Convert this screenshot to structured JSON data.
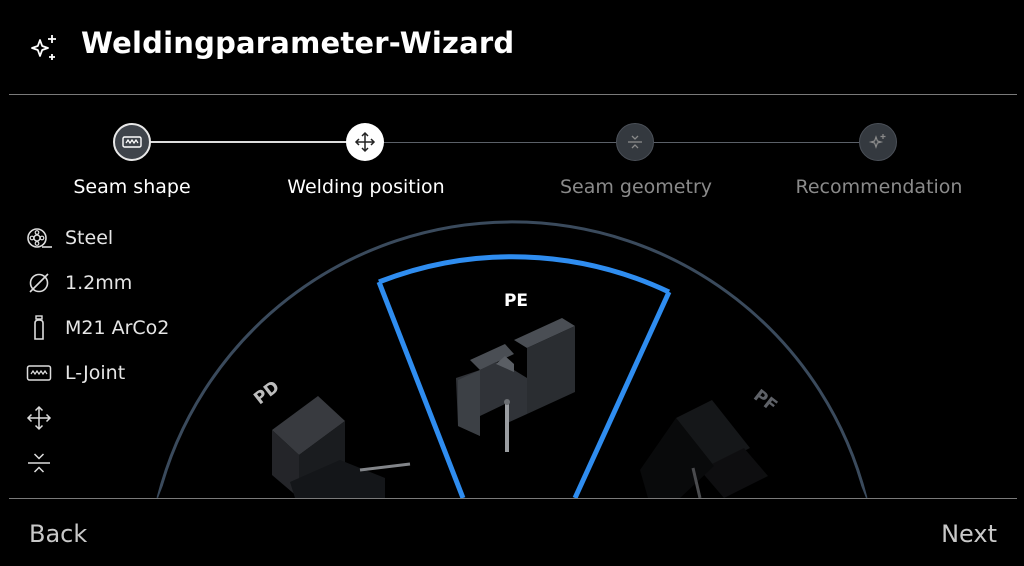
{
  "header": {
    "title": "Weldingparameter-Wizard",
    "icon": "sparkle-icon"
  },
  "stepper": {
    "steps": [
      {
        "label": "Seam shape",
        "icon": "seam-shape-icon",
        "state": "completed"
      },
      {
        "label": "Welding position",
        "icon": "move-arrows-icon",
        "state": "active"
      },
      {
        "label": "Seam geometry",
        "icon": "seam-geometry-icon",
        "state": "upcoming"
      },
      {
        "label": "Recommendation",
        "icon": "sparkle-icon",
        "state": "upcoming"
      }
    ]
  },
  "specs": {
    "material": "Steel",
    "wire_diameter": "1.2mm",
    "gas": "M21 ArCo2",
    "joint": "L-Joint"
  },
  "positions": {
    "items": [
      {
        "label": "PD",
        "selected": false
      },
      {
        "label": "PE",
        "selected": true
      },
      {
        "label": "PF",
        "selected": false
      }
    ]
  },
  "footer": {
    "back_label": "Back",
    "next_label": "Next"
  },
  "colors": {
    "accent": "#2f8df0",
    "arc": "#3a4a5c",
    "muted_text": "#8a8a8a",
    "step_inactive_fill": "#34393f"
  }
}
